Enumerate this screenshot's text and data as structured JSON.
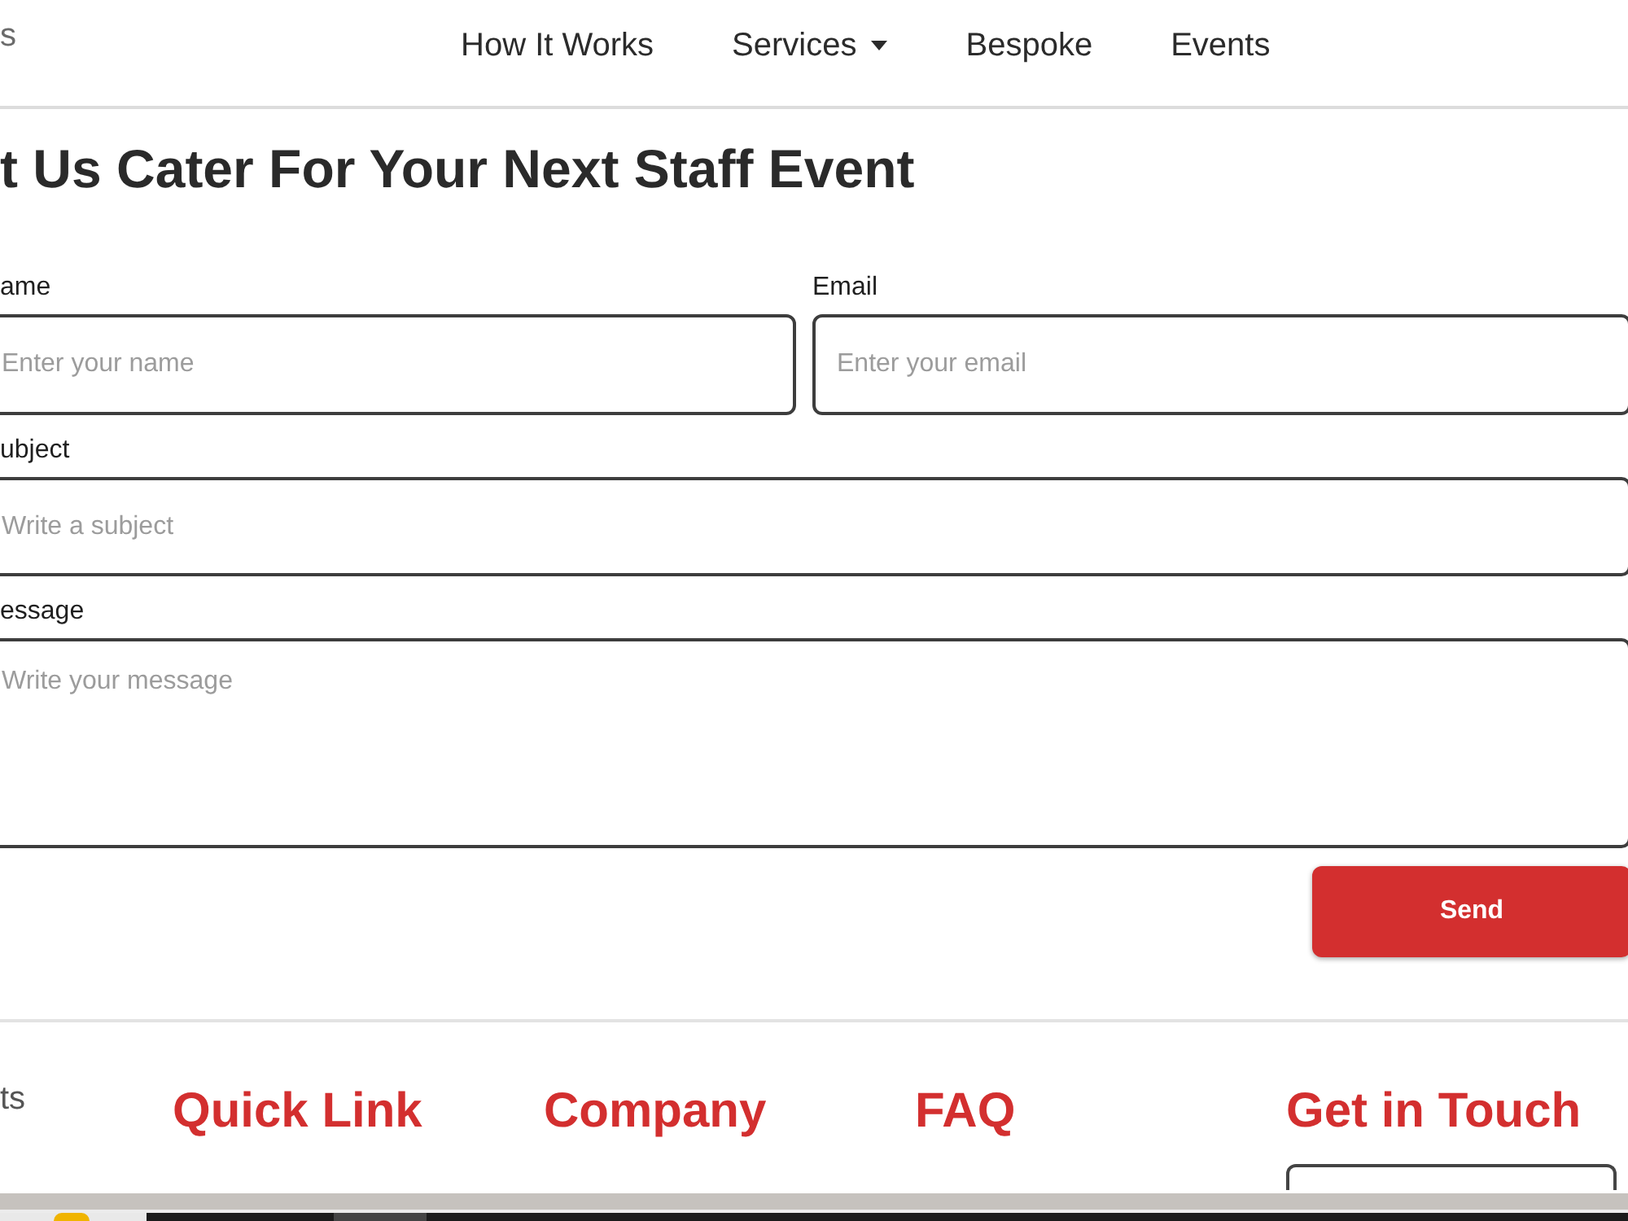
{
  "header": {
    "logo_text": "s",
    "nav": [
      {
        "label": "How It Works",
        "dropdown": false
      },
      {
        "label": "Services",
        "dropdown": true
      },
      {
        "label": "Bespoke",
        "dropdown": false
      },
      {
        "label": "Events",
        "dropdown": false
      }
    ]
  },
  "form": {
    "title": "t Us Cater For Your Next Staff Event",
    "rows": [
      {
        "fields": [
          {
            "label": "ame",
            "placeholder": "Enter your name",
            "kind": "input"
          },
          {
            "label": "Email",
            "placeholder": "Enter your email",
            "kind": "input"
          }
        ]
      },
      {
        "fields": [
          {
            "label": "ubject",
            "placeholder": "Write a subject",
            "kind": "input"
          }
        ]
      },
      {
        "fields": [
          {
            "label": "essage",
            "placeholder": "Write your message",
            "kind": "textarea"
          }
        ]
      }
    ],
    "submit": "Send"
  },
  "footer": {
    "brand_text": "ts",
    "columns": [
      {
        "heading": "Quick Link",
        "kind": "links"
      },
      {
        "heading": "Company",
        "kind": "links"
      },
      {
        "heading": "FAQ",
        "kind": "links"
      },
      {
        "heading": "Get in Touch",
        "kind": "input"
      }
    ]
  }
}
